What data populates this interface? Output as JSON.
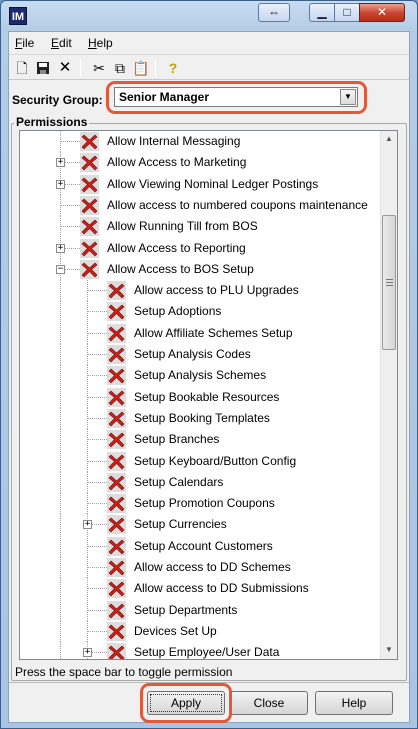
{
  "window": {
    "app_icon_label": "IM"
  },
  "menu": {
    "file": "File",
    "edit": "Edit",
    "help": "Help"
  },
  "security_group": {
    "label": "Security Group:",
    "selected": "Senior Manager"
  },
  "permissions": {
    "title": "Permissions",
    "items": [
      {
        "label": "Allow Internal Messaging",
        "level": 0,
        "expander": "none",
        "allowed": false
      },
      {
        "label": "Allow Access to Marketing",
        "level": 0,
        "expander": "plus",
        "allowed": false
      },
      {
        "label": "Allow Viewing Nominal Ledger Postings",
        "level": 0,
        "expander": "plus",
        "allowed": false
      },
      {
        "label": "Allow access to numbered coupons maintenance",
        "level": 0,
        "expander": "none",
        "allowed": false
      },
      {
        "label": "Allow Running Till from BOS",
        "level": 0,
        "expander": "none",
        "allowed": false
      },
      {
        "label": "Allow Access to Reporting",
        "level": 0,
        "expander": "plus",
        "allowed": false
      },
      {
        "label": "Allow Access to BOS Setup",
        "level": 0,
        "expander": "minus",
        "allowed": false
      },
      {
        "label": "Allow access to PLU Upgrades",
        "level": 1,
        "expander": "none",
        "allowed": false
      },
      {
        "label": "Setup Adoptions",
        "level": 1,
        "expander": "none",
        "allowed": false
      },
      {
        "label": "Allow Affiliate Schemes Setup",
        "level": 1,
        "expander": "none",
        "allowed": false
      },
      {
        "label": "Setup Analysis Codes",
        "level": 1,
        "expander": "none",
        "allowed": false
      },
      {
        "label": "Setup Analysis Schemes",
        "level": 1,
        "expander": "none",
        "allowed": false
      },
      {
        "label": "Setup Bookable Resources",
        "level": 1,
        "expander": "none",
        "allowed": false
      },
      {
        "label": "Setup Booking Templates",
        "level": 1,
        "expander": "none",
        "allowed": false
      },
      {
        "label": "Setup Branches",
        "level": 1,
        "expander": "none",
        "allowed": false
      },
      {
        "label": "Setup Keyboard/Button Config",
        "level": 1,
        "expander": "none",
        "allowed": false
      },
      {
        "label": "Setup Calendars",
        "level": 1,
        "expander": "none",
        "allowed": false
      },
      {
        "label": "Setup Promotion Coupons",
        "level": 1,
        "expander": "none",
        "allowed": false
      },
      {
        "label": "Setup Currencies",
        "level": 1,
        "expander": "plus",
        "allowed": false
      },
      {
        "label": "Setup Account Customers",
        "level": 1,
        "expander": "none",
        "allowed": false
      },
      {
        "label": "Allow access to DD Schemes",
        "level": 1,
        "expander": "none",
        "allowed": false
      },
      {
        "label": "Allow access to DD Submissions",
        "level": 1,
        "expander": "none",
        "allowed": false
      },
      {
        "label": "Setup Departments",
        "level": 1,
        "expander": "none",
        "allowed": false
      },
      {
        "label": "Devices Set Up",
        "level": 1,
        "expander": "none",
        "allowed": false
      },
      {
        "label": "Setup Employee/User Data",
        "level": 1,
        "expander": "plus",
        "allowed": false
      }
    ]
  },
  "status_text": "Press the space bar to toggle permission",
  "buttons": {
    "apply": "Apply",
    "close": "Close",
    "help": "Help"
  },
  "colors": {
    "deny_icon": "#c8201a",
    "highlight": "#e05a3a"
  },
  "toolbar_icons": [
    "new-icon",
    "save-icon",
    "delete-icon",
    "cut-icon",
    "copy-icon",
    "paste-icon",
    "help-icon"
  ]
}
